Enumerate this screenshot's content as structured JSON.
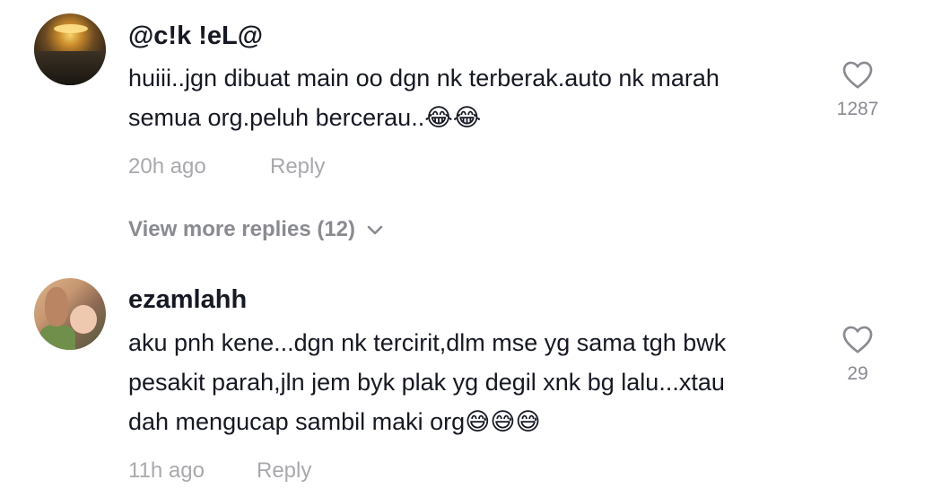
{
  "comments": [
    {
      "username": "@c!k !eL@",
      "text": "huiii..jgn dibuat main oo dgn nk terberak.auto nk marah semua org.peluh bercerau..😂😂",
      "time": "20h ago",
      "reply": "Reply",
      "likes": "1287",
      "icons": {
        "avatar": "avatar-sunset",
        "like": "heart-icon"
      }
    },
    {
      "username": "ezamlahh",
      "text": "aku pnh kene...dgn nk tercirit,dlm mse yg sama tgh bwk pesakit parah,jln jem byk plak yg degil xnk bg lalu...xtau dah mengucap sambil maki org😅😅😅",
      "time": "11h ago",
      "reply": "Reply",
      "likes": "29",
      "icons": {
        "avatar": "avatar-person-with-baby",
        "like": "heart-icon"
      }
    }
  ],
  "view_more": "View more replies (12)",
  "colors": {
    "text": "#161823",
    "muted": "#a8a9ad",
    "icon": "#8a8b91"
  }
}
